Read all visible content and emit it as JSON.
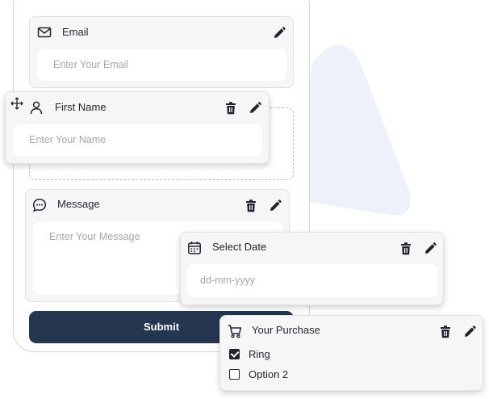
{
  "form": {
    "email": {
      "label": "Email",
      "placeholder": "Enter Your Email"
    },
    "first_name": {
      "label": "First Name",
      "placeholder": "Enter Your Name"
    },
    "message": {
      "label": "Message",
      "placeholder": "Enter Your Message"
    },
    "submit_label": "Submit"
  },
  "floating": {
    "date": {
      "label": "Select Date",
      "placeholder": "dd-mm-yyyy"
    },
    "purchase": {
      "label": "Your Purchase",
      "options": [
        {
          "label": "Ring",
          "checked": true
        },
        {
          "label": "Option 2",
          "checked": false
        }
      ]
    }
  },
  "icons": {
    "email": "mail-icon",
    "name": "user-icon",
    "message": "chat-bubble-icon",
    "date": "calendar-icon",
    "purchase": "cart-icon",
    "edit": "pencil-icon",
    "delete": "trash-icon",
    "drag": "move-icon"
  },
  "colors": {
    "submit_bg": "#243650",
    "card_bg": "#f6f6f7",
    "decor_triangle": "#edf1fa"
  }
}
